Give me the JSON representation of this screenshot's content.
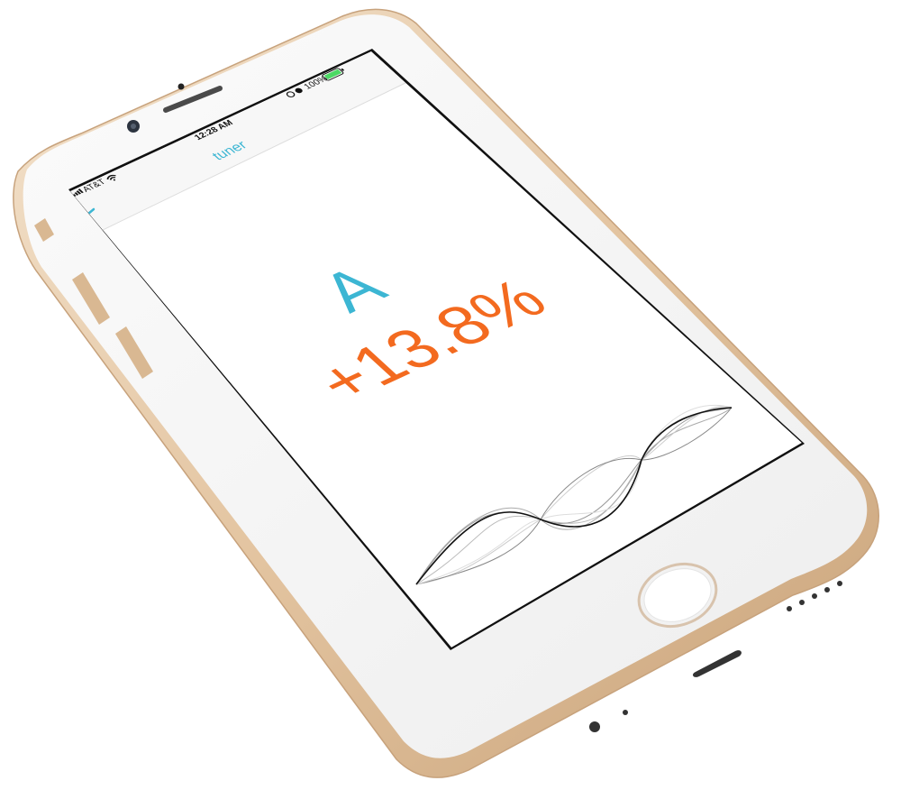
{
  "status_bar": {
    "carrier": "AT&T",
    "time": "12:28 AM",
    "battery": "100%"
  },
  "nav": {
    "title": "tuner",
    "back_glyph": "<"
  },
  "tuner": {
    "note": "A",
    "deviation": "+13.8%",
    "deviation_value": 13.8
  },
  "colors": {
    "accent_blue": "#3cb6d3",
    "accent_orange": "#f36a1f",
    "gold_frame": "#e6c9a6"
  },
  "icons": [
    "signal-bars-icon",
    "wifi-icon",
    "alarm-icon",
    "rotation-lock-icon",
    "battery-icon",
    "back-chevron-icon",
    "home-button-icon",
    "camera-icon",
    "earpiece-icon",
    "speaker-grille-icon",
    "headphone-jack-icon",
    "string-wave-icon"
  ]
}
